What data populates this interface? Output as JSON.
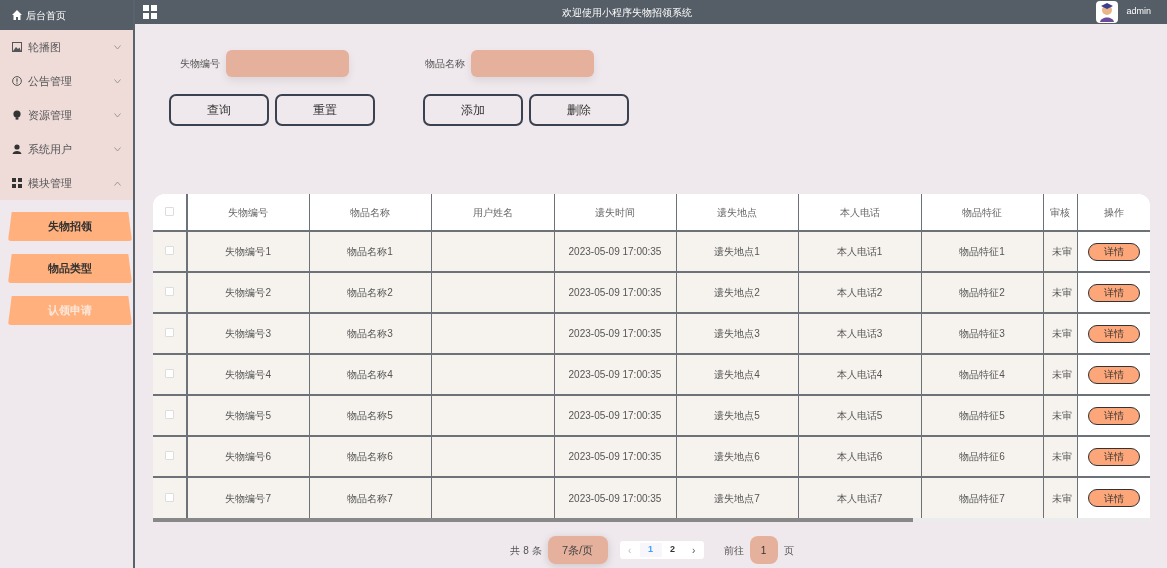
{
  "header": {
    "home": "后台首页",
    "title": "欢迎使用小程序失物招领系统",
    "user": "admin"
  },
  "sidebar": {
    "items": [
      {
        "label": "轮播图",
        "expanded": false
      },
      {
        "label": "公告管理",
        "expanded": false
      },
      {
        "label": "资源管理",
        "expanded": false
      },
      {
        "label": "系统用户",
        "expanded": false
      },
      {
        "label": "模块管理",
        "expanded": true,
        "children": [
          {
            "label": "失物招领",
            "selected": false
          },
          {
            "label": "物品类型",
            "selected": false
          },
          {
            "label": "认领申请",
            "selected": true
          }
        ]
      }
    ]
  },
  "search": {
    "fields": [
      {
        "label": "失物编号"
      },
      {
        "label": "物品名称"
      }
    ],
    "buttons": [
      "查询",
      "重置",
      "添加",
      "删除"
    ]
  },
  "table": {
    "all_checked": false,
    "columns": [
      "失物编号",
      "物品名称",
      "用户姓名",
      "遗失时间",
      "遗失地点",
      "本人电话",
      "物品特征",
      "审核",
      "操作"
    ],
    "rows": [
      {
        "checked": false,
        "cells": [
          "失物编号1",
          "物品名称1",
          "",
          "2023-05-09 17:00:35",
          "遗失地点1",
          "本人电话1",
          "物品特征1",
          "未审"
        ],
        "action": "详情"
      },
      {
        "checked": false,
        "cells": [
          "失物编号2",
          "物品名称2",
          "",
          "2023-05-09 17:00:35",
          "遗失地点2",
          "本人电话2",
          "物品特征2",
          "未审"
        ],
        "action": "详情"
      },
      {
        "checked": false,
        "cells": [
          "失物编号3",
          "物品名称3",
          "",
          "2023-05-09 17:00:35",
          "遗失地点3",
          "本人电话3",
          "物品特征3",
          "未审"
        ],
        "action": "详情"
      },
      {
        "checked": false,
        "cells": [
          "失物编号4",
          "物品名称4",
          "",
          "2023-05-09 17:00:35",
          "遗失地点4",
          "本人电话4",
          "物品特征4",
          "未审"
        ],
        "action": "详情"
      },
      {
        "checked": false,
        "cells": [
          "失物编号5",
          "物品名称5",
          "",
          "2023-05-09 17:00:35",
          "遗失地点5",
          "本人电话5",
          "物品特征5",
          "未审"
        ],
        "action": "详情"
      },
      {
        "checked": false,
        "cells": [
          "失物编号6",
          "物品名称6",
          "",
          "2023-05-09 17:00:35",
          "遗失地点6",
          "本人电话6",
          "物品特征6",
          "未审"
        ],
        "action": "详情"
      },
      {
        "checked": false,
        "cells": [
          "失物编号7",
          "物品名称7",
          "",
          "2023-05-09 17:00:35",
          "遗失地点7",
          "本人电话7",
          "物品特征7",
          "未审"
        ],
        "action": "详情"
      }
    ]
  },
  "pagination": {
    "total": "共 8 条",
    "page_size": "7条/页",
    "prev": "‹",
    "pages": [
      {
        "label": "1",
        "selected": true
      },
      {
        "label": "2",
        "selected": false
      }
    ],
    "next": "›",
    "goto_label": "前往",
    "goto_value": "1",
    "goto_suffix": "页"
  }
}
